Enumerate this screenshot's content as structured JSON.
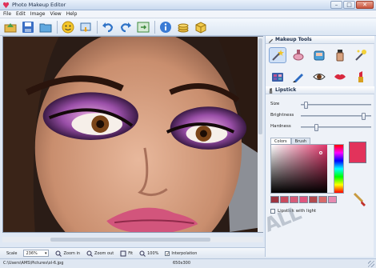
{
  "window": {
    "title": "Photo Makeup Editor",
    "buttons": {
      "minimize": "–",
      "maximize": "□",
      "close": "✕"
    }
  },
  "menu": [
    "File",
    "Edit",
    "Image",
    "View",
    "Help"
  ],
  "toolbar": {
    "icons": [
      "open-icon",
      "save-icon",
      "folder-icon",
      "smiley-icon",
      "export-icon",
      "undo-icon",
      "redo-icon",
      "before-after-icon",
      "info-icon",
      "coins-icon",
      "box-icon"
    ]
  },
  "panel": {
    "makeup_title": "Makeup Tools",
    "lipstick_title": "Lipstick",
    "size_label": "Size",
    "brightness_label": "Brightness",
    "hardness_label": "Hardness",
    "size_value": 0.05,
    "brightness_value": 0.92,
    "hardness_value": 0.2,
    "tabs": [
      "Colors",
      "Brush"
    ],
    "current_color": "#e2335b",
    "swatches": [
      "#9c3440",
      "#c94a5e",
      "#d65b78",
      "#e0567e",
      "#b24a4e",
      "#d76a6a",
      "#e68ab0"
    ],
    "lipstick_light_label": "Lipstick with light",
    "lipstick_light_checked": false
  },
  "bottom": {
    "scale_label": "Scale",
    "scale_value": "236%",
    "zoom_in": "Zoom in",
    "zoom_out": "Zoom out",
    "fit": "Fit",
    "hundred": "100%",
    "interpolation": "Interpolation",
    "interpolation_checked": true
  },
  "status": {
    "path": "C:\\Users\\AMS\\Pictures\\ol-6.jpg",
    "dims": "650x300"
  },
  "watermark": "ALL"
}
